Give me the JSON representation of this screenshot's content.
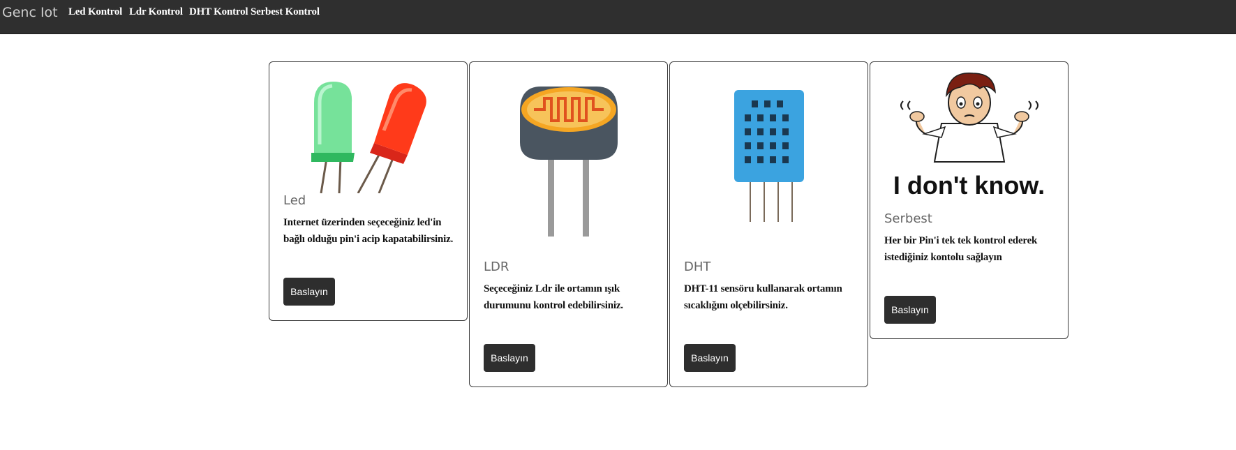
{
  "navbar": {
    "brand": "Genc Iot",
    "links": [
      "Led Kontrol",
      "Ldr Kontrol",
      "DHT Kontrol",
      "Serbest Kontrol"
    ]
  },
  "cards": [
    {
      "image": "led-image",
      "title": "Led",
      "text": "Internet üzerinden seçeceğiniz led'in bağlı olduğu pin'i acip kapatabilirsiniz.",
      "button": "Baslayın"
    },
    {
      "image": "ldr-image",
      "title": "LDR",
      "text": "Seçeceğiniz Ldr ile ortamın ışık durumunu kontrol edebilirsiniz.",
      "button": "Baslayın"
    },
    {
      "image": "dht-sensor-image",
      "title": "DHT",
      "text": "DHT-11 sensöru kullanarak ortamın sıcaklığını olçebilirsiniz.",
      "button": "Baslayın"
    },
    {
      "image": "confused-man-image",
      "image_caption": "I don't know.",
      "title": "Serbest",
      "text": "Her bir Pin'i tek tek kontrol ederek istediğiniz kontolu sağlayın",
      "button": "Baslayın"
    }
  ],
  "colors": {
    "navbar_bg": "#2f2f2f",
    "button_bg": "#2e2e2e",
    "card_border": "#3a3a3a",
    "led_green": "#4cd37a",
    "led_red": "#ff3a1a",
    "ldr_orange": "#f5a623",
    "dht_blue": "#3ba3e0"
  }
}
